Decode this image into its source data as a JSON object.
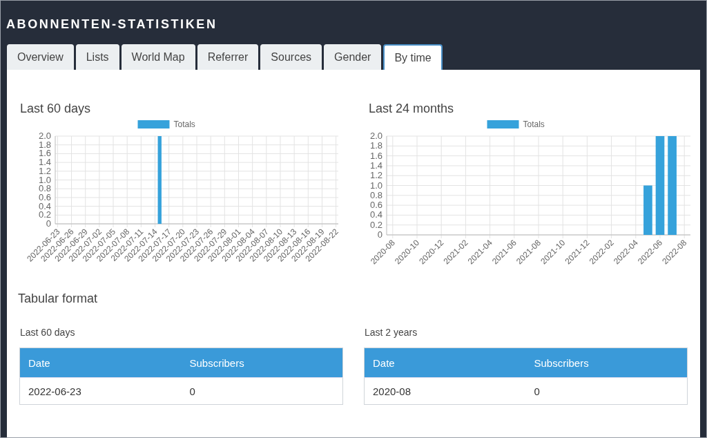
{
  "page_title": "ABONNENTEN-STATISTIKEN",
  "tabs": [
    {
      "label": "Overview",
      "selected": false
    },
    {
      "label": "Lists",
      "selected": false
    },
    {
      "label": "World Map",
      "selected": false
    },
    {
      "label": "Referrer",
      "selected": false
    },
    {
      "label": "Sources",
      "selected": false
    },
    {
      "label": "Gender",
      "selected": false
    },
    {
      "label": "By time",
      "selected": true
    }
  ],
  "charts": [
    {
      "heading": "Last 60 days",
      "chart_data": {
        "type": "bar",
        "grid": true,
        "categories": [
          "2022-06-23",
          null,
          null,
          "2022-06-26",
          null,
          null,
          "2022-06-29",
          null,
          null,
          "2022-07-02",
          null,
          null,
          "2022-07-05",
          null,
          null,
          "2022-07-08",
          null,
          null,
          "2022-07-11",
          null,
          null,
          "2022-07-14",
          null,
          null,
          "2022-07-17",
          null,
          null,
          "2022-07-20",
          null,
          null,
          "2022-07-23",
          null,
          null,
          "2022-07-26",
          null,
          null,
          "2022-07-29",
          null,
          null,
          "2022-08-01",
          null,
          null,
          "2022-08-04",
          null,
          null,
          "2022-08-07",
          null,
          null,
          "2022-08-10",
          null,
          null,
          "2022-08-13",
          null,
          null,
          "2022-08-16",
          null,
          null,
          "2022-08-19",
          null,
          null,
          "2022-08-22"
        ],
        "series": [
          {
            "name": "Totals",
            "color": "#36a2db",
            "values": [
              0,
              0,
              0,
              0,
              0,
              0,
              0,
              0,
              0,
              0,
              0,
              0,
              0,
              0,
              0,
              0,
              0,
              0,
              0,
              0,
              0,
              0,
              2,
              0,
              0,
              0,
              0,
              0,
              0,
              0,
              0,
              0,
              0,
              0,
              0,
              0,
              0,
              0,
              0,
              0,
              0,
              0,
              0,
              0,
              0,
              0,
              0,
              0,
              0,
              0,
              0,
              0,
              0,
              0,
              0,
              0,
              0,
              0,
              0,
              0,
              0
            ]
          }
        ],
        "ylim": [
          0,
          2
        ],
        "yticks": [
          {
            "value": 0,
            "label": "0"
          },
          {
            "value": 0.2,
            "label": "0.2"
          },
          {
            "value": 0.4,
            "label": "0.4"
          },
          {
            "value": 0.6,
            "label": "0.6"
          },
          {
            "value": 0.8,
            "label": "0.8"
          },
          {
            "value": 1,
            "label": "1.0"
          },
          {
            "value": 1.2,
            "label": "1.2"
          },
          {
            "value": 1.4,
            "label": "1.4"
          },
          {
            "value": 1.6,
            "label": "1.6"
          },
          {
            "value": 1.8,
            "label": "1.8"
          },
          {
            "value": 2,
            "label": "2.0"
          }
        ]
      }
    },
    {
      "heading": "Last 24 months",
      "chart_data": {
        "type": "bar",
        "grid": true,
        "categories": [
          "2020-08",
          null,
          "2020-10",
          null,
          "2020-12",
          null,
          "2021-02",
          null,
          "2021-04",
          null,
          "2021-06",
          null,
          "2021-08",
          null,
          "2021-10",
          null,
          "2021-12",
          null,
          "2022-02",
          null,
          "2022-04",
          null,
          "2022-06",
          null,
          "2022-08"
        ],
        "series": [
          {
            "name": "Totals",
            "color": "#36a2db",
            "values": [
              0,
              0,
              0,
              0,
              0,
              0,
              0,
              0,
              0,
              0,
              0,
              0,
              0,
              0,
              0,
              0,
              0,
              0,
              0,
              0,
              0,
              1,
              2,
              2,
              0
            ]
          }
        ],
        "ylim": [
          0,
          2
        ],
        "yticks": [
          {
            "value": 0,
            "label": "0"
          },
          {
            "value": 0.2,
            "label": "0.2"
          },
          {
            "value": 0.4,
            "label": "0.4"
          },
          {
            "value": 0.6,
            "label": "0.6"
          },
          {
            "value": 0.8,
            "label": "0.8"
          },
          {
            "value": 1,
            "label": "1.0"
          },
          {
            "value": 1.2,
            "label": "1.2"
          },
          {
            "value": 1.4,
            "label": "1.4"
          },
          {
            "value": 1.6,
            "label": "1.6"
          },
          {
            "value": 1.8,
            "label": "1.8"
          },
          {
            "value": 2,
            "label": "2.0"
          }
        ]
      }
    }
  ],
  "tabular_heading": "Tabular format",
  "tables": [
    {
      "caption": "Last 60 days",
      "columns": [
        "Date",
        "Subscribers"
      ],
      "rows": [
        [
          "2022-06-23",
          "0"
        ]
      ]
    },
    {
      "caption": "Last 2 years",
      "columns": [
        "Date",
        "Subscribers"
      ],
      "rows": [
        [
          "2020-08",
          "0"
        ]
      ]
    }
  ]
}
